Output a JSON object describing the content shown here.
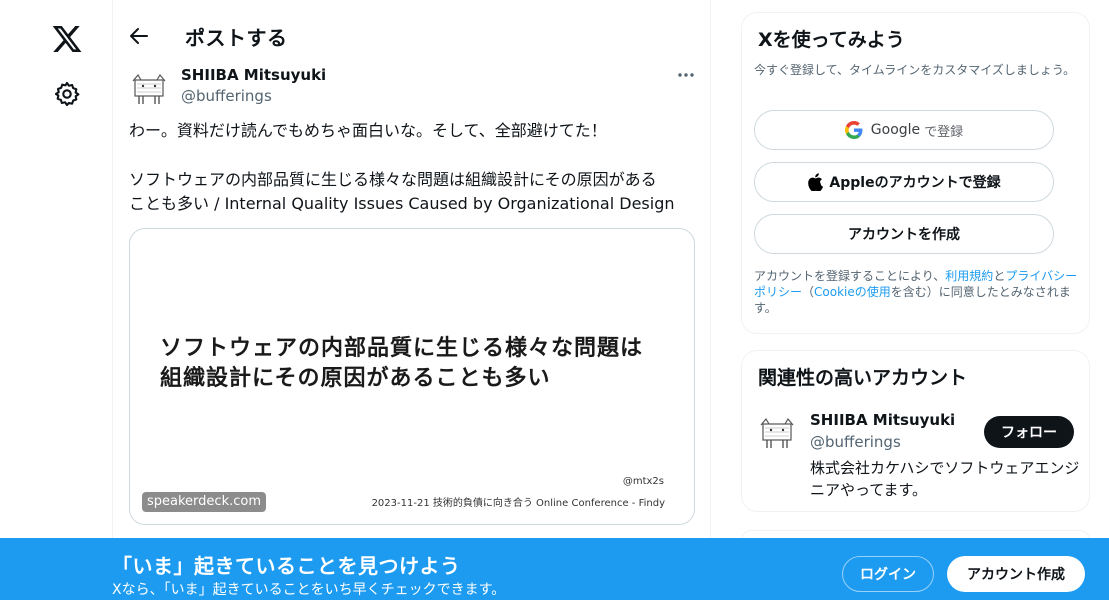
{
  "colors": {
    "brand": "#1d9bf0",
    "text": "#0f1419",
    "muted": "#536471",
    "link": "#1d9bf0"
  },
  "rail": {
    "logo_icon": "x-logo-icon",
    "settings_icon": "gear-icon"
  },
  "header": {
    "back_icon": "arrow-left-icon",
    "title": "ポストする"
  },
  "post": {
    "author_name": "SHIIBA Mitsuyuki",
    "author_handle": "@bufferings",
    "more_icon": "more-dots-icon",
    "text_lines": [
      "わー。資料だけ読んでもめちゃ面白いな。そして、全部避けてた！",
      "",
      "ソフトウェアの内部品質に生じる様々な問題は組織設計にその原因がある",
      "ことも多い / Internal Quality Issues Caused by Organizational Design"
    ],
    "card": {
      "slide_lines": [
        "ソフトウェアの内部品質に生じる様々な問題は",
        "組織設計にその原因があることも多い"
      ],
      "slide_author": "@mtx2s",
      "slide_footer": "2023-11-21 技術的負債に向き合う Online Conference - Findy",
      "domain": "speakerdeck.com"
    }
  },
  "sidebar": {
    "signup": {
      "title": "Xを使ってみよう",
      "subtitle": "今すぐ登録して、タイムラインをカスタマイズしましょう。",
      "google_label": "Google",
      "google_suffix": "で登録",
      "apple_label": "Appleのアカウントで登録",
      "create_label": "アカウントを作成",
      "legal_before": "アカウントを登録することにより、",
      "terms_link": "利用規約",
      "and": "と",
      "privacy_link": "プライバシーポリシー",
      "paren_open": "（",
      "cookie_link": "Cookieの使用",
      "legal_after": "を含む）に同意したとみなされます。"
    },
    "related": {
      "title": "関連性の高いアカウント",
      "name": "SHIIBA Mitsuyuki",
      "handle": "@bufferings",
      "follow_label": "フォロー",
      "bio": "株式会社カケハシでソフトウェアエンジニアやってます。"
    }
  },
  "bottom_bar": {
    "title": "「いま」起きていることを見つけよう",
    "subtitle": "Xなら、「いま」起きていることをいち早くチェックできます。",
    "login_label": "ログイン",
    "signup_label": "アカウント作成"
  }
}
